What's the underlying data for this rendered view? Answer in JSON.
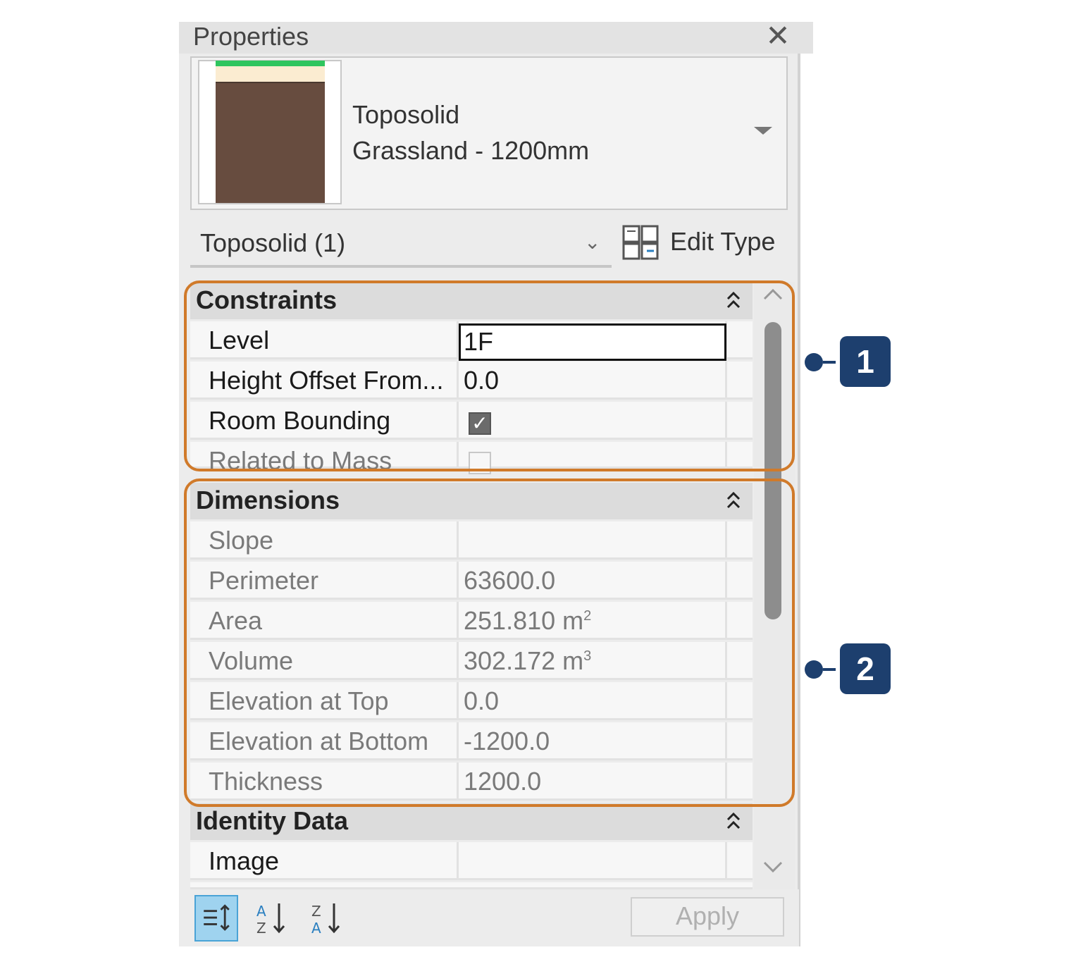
{
  "panel": {
    "title": "Properties",
    "close_symbol": "✕"
  },
  "type_selector": {
    "family": "Toposolid",
    "type": "Grassland - 1200mm"
  },
  "instance_filter": {
    "label": "Toposolid (1)",
    "chevron": "⌄"
  },
  "edit_type": {
    "label": "Edit Type"
  },
  "groups": {
    "constraints": {
      "title": "Constraints",
      "rows": [
        {
          "name": "Level",
          "value": "1F"
        },
        {
          "name": "Height Offset From...",
          "value": "0.0"
        },
        {
          "name": "Room Bounding",
          "value": "",
          "checked": true
        },
        {
          "name": "Related to Mass",
          "value": "",
          "checked": false
        }
      ]
    },
    "dimensions": {
      "title": "Dimensions",
      "rows": [
        {
          "name": "Slope",
          "value": ""
        },
        {
          "name": "Perimeter",
          "value": "63600.0"
        },
        {
          "name": "Area",
          "value": "251.810 m",
          "unit_exp": "2"
        },
        {
          "name": "Volume",
          "value": "302.172 m",
          "unit_exp": "3"
        },
        {
          "name": "Elevation at Top",
          "value": "0.0"
        },
        {
          "name": "Elevation at Bottom",
          "value": "-1200.0"
        },
        {
          "name": "Thickness",
          "value": "1200.0"
        }
      ]
    },
    "identity_data": {
      "title": "Identity Data",
      "rows": [
        {
          "name": "Image",
          "value": ""
        }
      ]
    }
  },
  "footer": {
    "apply_label": "Apply"
  },
  "callouts": {
    "one": "1",
    "two": "2"
  },
  "colors": {
    "callout_border": "#d07a2a",
    "badge": "#1d3f6e",
    "soil": "#674c3f",
    "grass": "#2fc55e",
    "sand": "#fbecd1"
  },
  "icons": [
    "close-icon",
    "dropdown-icon",
    "edit-type-icon",
    "collapse-icon",
    "checkbox-icon",
    "scroll-up-icon",
    "scroll-down-icon",
    "sort-categorized-icon",
    "sort-ascending-icon",
    "sort-descending-icon"
  ]
}
